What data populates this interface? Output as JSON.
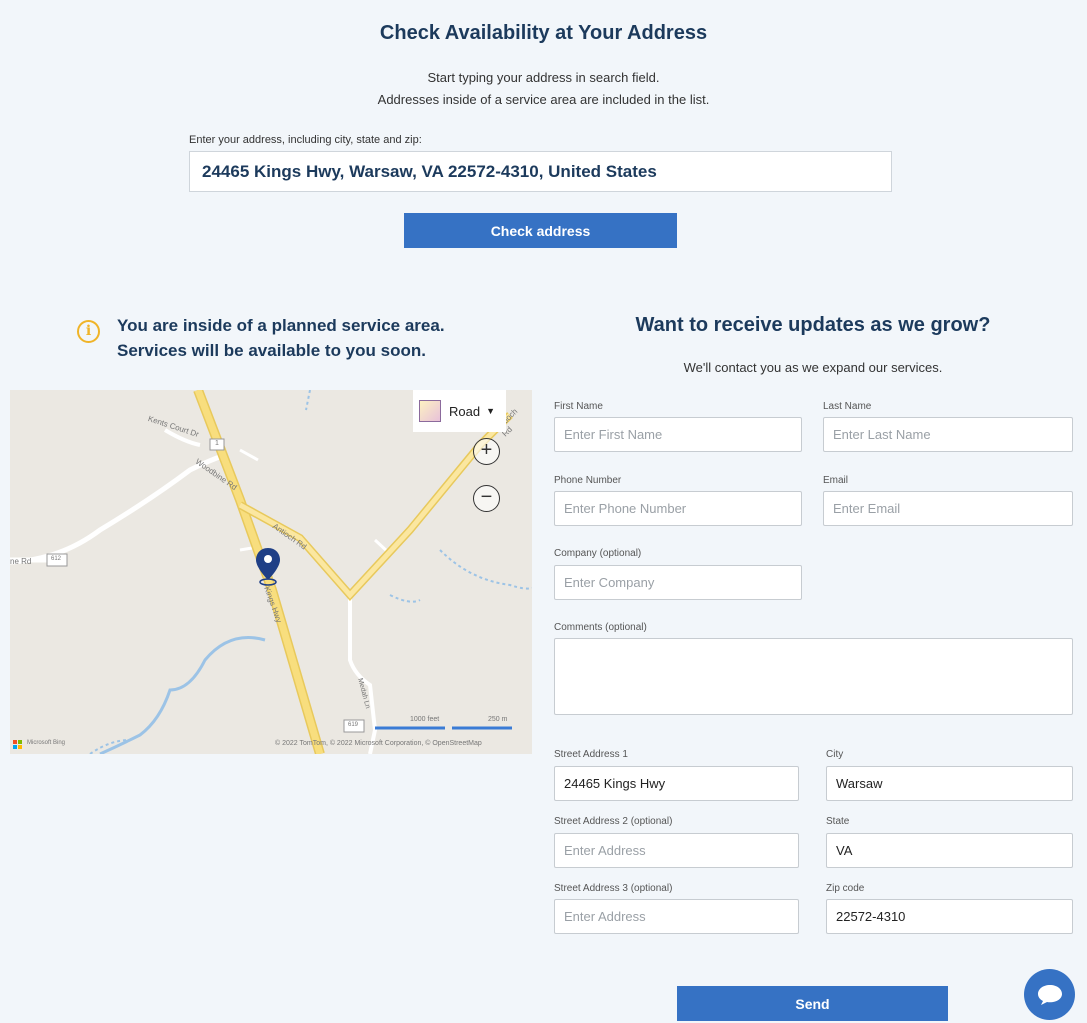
{
  "header": {
    "title": "Check Availability at Your Address",
    "line1": "Start typing your address in search field.",
    "line2": "Addresses inside of a service area are included in the list.",
    "address_label": "Enter your address, including city, state and zip:",
    "address_value": "24465 Kings Hwy, Warsaw, VA 22572-4310, United States",
    "check_button": "Check address"
  },
  "notice": {
    "line1": "You are inside of a planned service area.",
    "line2": "Services will be available to you soon.",
    "icon": "info-icon",
    "icon_color": "#f0b428"
  },
  "map": {
    "style_label": "Road",
    "labels": {
      "kents": "Kents Court Dr",
      "woodbine": "Woodbine Rd",
      "antioch": "Antioch Rd",
      "antioch_top": "Antioch Rd",
      "kings": "Kings Hwy",
      "ne": "ne Rd",
      "shield_612": "612",
      "shield_619": "619",
      "shield_us": "1",
      "medah": "Medah Ln"
    },
    "scale_feet": "1000 feet",
    "scale_m": "250 m",
    "attribution": "© 2022 TomTom, © 2022 Microsoft Corporation, © OpenStreetMap",
    "brand": "Microsoft Bing"
  },
  "form": {
    "title": "Want to receive updates as we grow?",
    "subtitle": "We'll contact you as we expand our services.",
    "first_name_label": "First Name",
    "first_name_placeholder": "Enter First Name",
    "last_name_label": "Last Name",
    "last_name_placeholder": "Enter Last Name",
    "phone_label": "Phone Number",
    "phone_placeholder": "Enter Phone Number",
    "email_label": "Email",
    "email_placeholder": "Enter Email",
    "company_label": "Company (optional)",
    "company_placeholder": "Enter Company",
    "comments_label": "Comments (optional)",
    "street1_label": "Street Address 1",
    "street1_value": "24465 Kings Hwy",
    "city_label": "City",
    "city_value": "Warsaw",
    "street2_label": "Street Address 2 (optional)",
    "street2_placeholder": "Enter Address",
    "state_label": "State",
    "state_value": "VA",
    "street3_label": "Street Address 3 (optional)",
    "street3_placeholder": "Enter Address",
    "zip_label": "Zip code",
    "zip_value": "22572-4310",
    "send_button": "Send"
  },
  "colors": {
    "accent": "#3672c4",
    "heading": "#1c3a5c",
    "background": "#f2f6fa"
  }
}
